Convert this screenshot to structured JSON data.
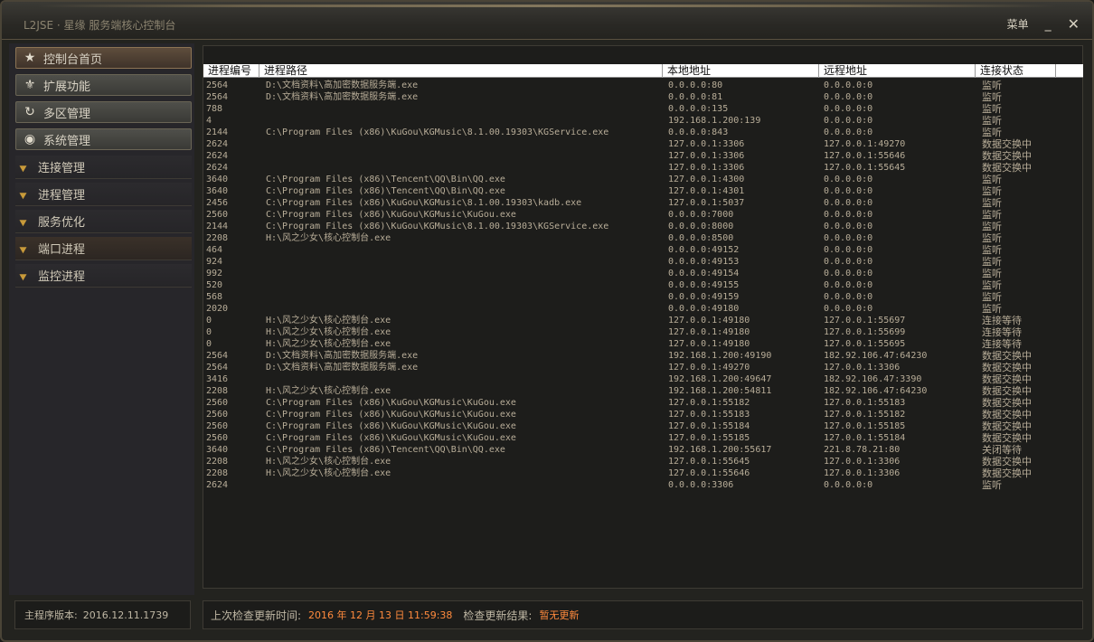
{
  "title": "L2JSE · 星缘 服务端核心控制台",
  "controls": {
    "menu": "菜单",
    "minimize": "_",
    "close": "✕"
  },
  "nav": {
    "main": [
      {
        "label": "控制台首页",
        "icon": "star-icon"
      },
      {
        "label": "扩展功能",
        "icon": "fleur-icon"
      },
      {
        "label": "多区管理",
        "icon": "refresh-icon"
      },
      {
        "label": "系统管理",
        "icon": "eye-icon"
      }
    ],
    "sub": [
      {
        "label": "连接管理"
      },
      {
        "label": "进程管理"
      },
      {
        "label": "服务优化"
      },
      {
        "label": "端口进程"
      },
      {
        "label": "监控进程"
      }
    ]
  },
  "version": {
    "label": "主程序版本:",
    "value": "2016.12.11.1739"
  },
  "table": {
    "headers": [
      "进程编号",
      "进程路径",
      "本地地址",
      "远程地址",
      "连接状态"
    ],
    "rows": [
      [
        "2564",
        "D:\\文档资料\\高加密数据服务端.exe",
        "0.0.0.0:80",
        "0.0.0.0:0",
        "监听"
      ],
      [
        "2564",
        "D:\\文档资料\\高加密数据服务端.exe",
        "0.0.0.0:81",
        "0.0.0.0:0",
        "监听"
      ],
      [
        "788",
        "",
        "0.0.0.0:135",
        "0.0.0.0:0",
        "监听"
      ],
      [
        "4",
        "",
        "192.168.1.200:139",
        "0.0.0.0:0",
        "监听"
      ],
      [
        "2144",
        "C:\\Program Files (x86)\\KuGou\\KGMusic\\8.1.00.19303\\KGService.exe",
        "0.0.0.0:843",
        "0.0.0.0:0",
        "监听"
      ],
      [
        "2624",
        "",
        "127.0.0.1:3306",
        "127.0.0.1:49270",
        "数据交换中"
      ],
      [
        "2624",
        "",
        "127.0.0.1:3306",
        "127.0.0.1:55646",
        "数据交换中"
      ],
      [
        "2624",
        "",
        "127.0.0.1:3306",
        "127.0.0.1:55645",
        "数据交换中"
      ],
      [
        "3640",
        "C:\\Program Files (x86)\\Tencent\\QQ\\Bin\\QQ.exe",
        "127.0.0.1:4300",
        "0.0.0.0:0",
        "监听"
      ],
      [
        "3640",
        "C:\\Program Files (x86)\\Tencent\\QQ\\Bin\\QQ.exe",
        "127.0.0.1:4301",
        "0.0.0.0:0",
        "监听"
      ],
      [
        "2456",
        "C:\\Program Files (x86)\\KuGou\\KGMusic\\8.1.00.19303\\kadb.exe",
        "127.0.0.1:5037",
        "0.0.0.0:0",
        "监听"
      ],
      [
        "2560",
        "C:\\Program Files (x86)\\KuGou\\KGMusic\\KuGou.exe",
        "0.0.0.0:7000",
        "0.0.0.0:0",
        "监听"
      ],
      [
        "2144",
        "C:\\Program Files (x86)\\KuGou\\KGMusic\\8.1.00.19303\\KGService.exe",
        "0.0.0.0:8000",
        "0.0.0.0:0",
        "监听"
      ],
      [
        "2208",
        "H:\\风之少女\\核心控制台.exe",
        "0.0.0.0:8500",
        "0.0.0.0:0",
        "监听"
      ],
      [
        "464",
        "",
        "0.0.0.0:49152",
        "0.0.0.0:0",
        "监听"
      ],
      [
        "924",
        "",
        "0.0.0.0:49153",
        "0.0.0.0:0",
        "监听"
      ],
      [
        "992",
        "",
        "0.0.0.0:49154",
        "0.0.0.0:0",
        "监听"
      ],
      [
        "520",
        "",
        "0.0.0.0:49155",
        "0.0.0.0:0",
        "监听"
      ],
      [
        "568",
        "",
        "0.0.0.0:49159",
        "0.0.0.0:0",
        "监听"
      ],
      [
        "2020",
        "",
        "0.0.0.0:49180",
        "0.0.0.0:0",
        "监听"
      ],
      [
        "0",
        "H:\\风之少女\\核心控制台.exe",
        "127.0.0.1:49180",
        "127.0.0.1:55697",
        "连接等待"
      ],
      [
        "0",
        "H:\\风之少女\\核心控制台.exe",
        "127.0.0.1:49180",
        "127.0.0.1:55699",
        "连接等待"
      ],
      [
        "0",
        "H:\\风之少女\\核心控制台.exe",
        "127.0.0.1:49180",
        "127.0.0.1:55695",
        "连接等待"
      ],
      [
        "2564",
        "D:\\文档资料\\高加密数据服务端.exe",
        "192.168.1.200:49190",
        "182.92.106.47:64230",
        "数据交换中"
      ],
      [
        "2564",
        "D:\\文档资料\\高加密数据服务端.exe",
        "127.0.0.1:49270",
        "127.0.0.1:3306",
        "数据交换中"
      ],
      [
        "3416",
        "",
        "192.168.1.200:49647",
        "182.92.106.47:3390",
        "数据交换中"
      ],
      [
        "2208",
        "H:\\风之少女\\核心控制台.exe",
        "192.168.1.200:54811",
        "182.92.106.47:64230",
        "数据交换中"
      ],
      [
        "2560",
        "C:\\Program Files (x86)\\KuGou\\KGMusic\\KuGou.exe",
        "127.0.0.1:55182",
        "127.0.0.1:55183",
        "数据交换中"
      ],
      [
        "2560",
        "C:\\Program Files (x86)\\KuGou\\KGMusic\\KuGou.exe",
        "127.0.0.1:55183",
        "127.0.0.1:55182",
        "数据交换中"
      ],
      [
        "2560",
        "C:\\Program Files (x86)\\KuGou\\KGMusic\\KuGou.exe",
        "127.0.0.1:55184",
        "127.0.0.1:55185",
        "数据交换中"
      ],
      [
        "2560",
        "C:\\Program Files (x86)\\KuGou\\KGMusic\\KuGou.exe",
        "127.0.0.1:55185",
        "127.0.0.1:55184",
        "数据交换中"
      ],
      [
        "3640",
        "C:\\Program Files (x86)\\Tencent\\QQ\\Bin\\QQ.exe",
        "192.168.1.200:55617",
        "221.8.78.21:80",
        "关闭等待"
      ],
      [
        "2208",
        "H:\\风之少女\\核心控制台.exe",
        "127.0.0.1:55645",
        "127.0.0.1:3306",
        "数据交换中"
      ],
      [
        "2208",
        "H:\\风之少女\\核心控制台.exe",
        "127.0.0.1:55646",
        "127.0.0.1:3306",
        "数据交换中"
      ],
      [
        "2624",
        "",
        "0.0.0.0:3306",
        "0.0.0.0:0",
        "监听"
      ]
    ]
  },
  "status": {
    "last_check_label": "上次检查更新时间:",
    "last_check_value": "2016 年 12 月 13 日 11:59:38",
    "result_label": "检查更新结果:",
    "result_value": "暂无更新"
  },
  "colors": {
    "accent": "#ff8a3d",
    "header_bg": "#ffffff",
    "text": "#b8ad98"
  }
}
